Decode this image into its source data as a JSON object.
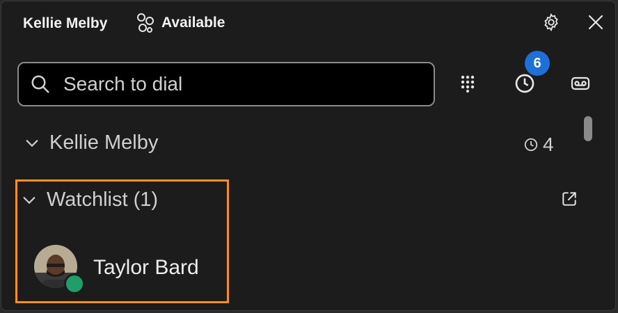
{
  "header": {
    "user_name": "Kellie Melby",
    "presence_label": "Available",
    "settings_icon": "gear-icon",
    "close_icon": "close-icon"
  },
  "search": {
    "placeholder": "Search to dial"
  },
  "toolbar": {
    "dialpad_icon": "dialpad-icon",
    "recent_icon": "clock-icon",
    "recent_badge": "6",
    "voicemail_icon": "voicemail-icon"
  },
  "sections": {
    "own_line": {
      "label": "Kellie Melby",
      "count": "4"
    },
    "watchlist": {
      "label": "Watchlist (1)",
      "open_icon": "open-external-icon",
      "contacts": [
        {
          "name": "Taylor Bard",
          "status": "available",
          "status_color": "#1e9f6a"
        }
      ]
    }
  },
  "colors": {
    "background": "#1c1c1c",
    "badge": "#1e6fd8",
    "highlight": "#f5901e",
    "presence_available": "#1e9f6a"
  }
}
